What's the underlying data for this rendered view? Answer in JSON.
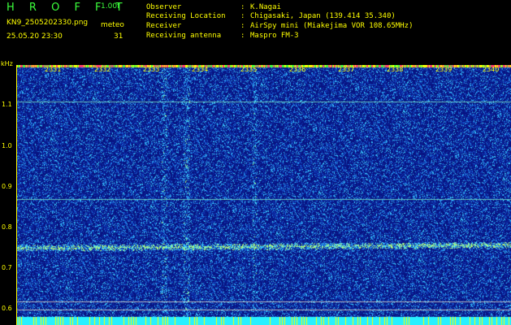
{
  "header": {
    "brand": "H R O F F T",
    "version": "1.00f",
    "filename": "KN9_2505202330.png",
    "meteo_label": "meteo",
    "datetime": "25.05.20 23:30",
    "meteo_value": "31"
  },
  "station": [
    {
      "key": "Observer",
      "value": "K.Nagai"
    },
    {
      "key": "Receiving Location",
      "value": "Chigasaki, Japan (139.414 35.340)"
    },
    {
      "key": "Receiver",
      "value": "AirSpy mini (Miakejima VOR 108.65MHz)"
    },
    {
      "key": "Receiving antenna",
      "value": "Maspro FM-3"
    }
  ],
  "axis": {
    "y_unit": "kHz",
    "y_labels": [
      "1.1",
      "1.0",
      "0.9",
      "0.8",
      "0.7",
      "0.6"
    ],
    "time_labels": [
      "2331",
      "2332",
      "2333",
      "2334",
      "2335",
      "2336",
      "2337",
      "2338",
      "2339",
      "2340"
    ]
  },
  "colors": {
    "header_text": "#ffff00",
    "brand": "#3cff3c",
    "background_noise": "#0a1a8c",
    "signal": "#28d8ff"
  }
}
